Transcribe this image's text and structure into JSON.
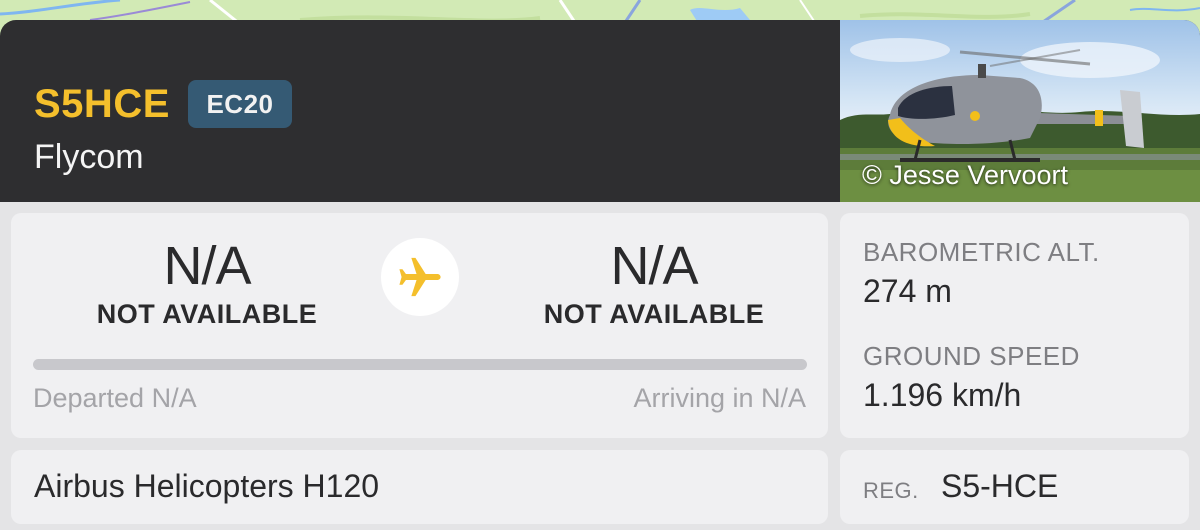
{
  "flight": {
    "callsign": "S5HCE",
    "aircraft_type": "EC20",
    "airline": "Flycom",
    "photo_credit": "© Jesse Vervoort"
  },
  "route": {
    "origin": {
      "code": "N/A",
      "name": "NOT AVAILABLE"
    },
    "destination": {
      "code": "N/A",
      "name": "NOT AVAILABLE"
    },
    "departed": "Departed N/A",
    "arriving": "Arriving in N/A",
    "progress_percent": 0
  },
  "stats": {
    "altitude_label": "BAROMETRIC ALT.",
    "altitude_value": "274 m",
    "speed_label": "GROUND SPEED",
    "speed_value": "1.196 km/h"
  },
  "aircraft": {
    "model": "Airbus Helicopters H120",
    "reg_label": "REG.",
    "reg_value": "S5-HCE"
  },
  "icons": {
    "plane": "airplane-icon"
  },
  "colors": {
    "accent": "#f4bf2c",
    "header_bg": "#2e2e30",
    "badge_bg": "#355a74"
  }
}
